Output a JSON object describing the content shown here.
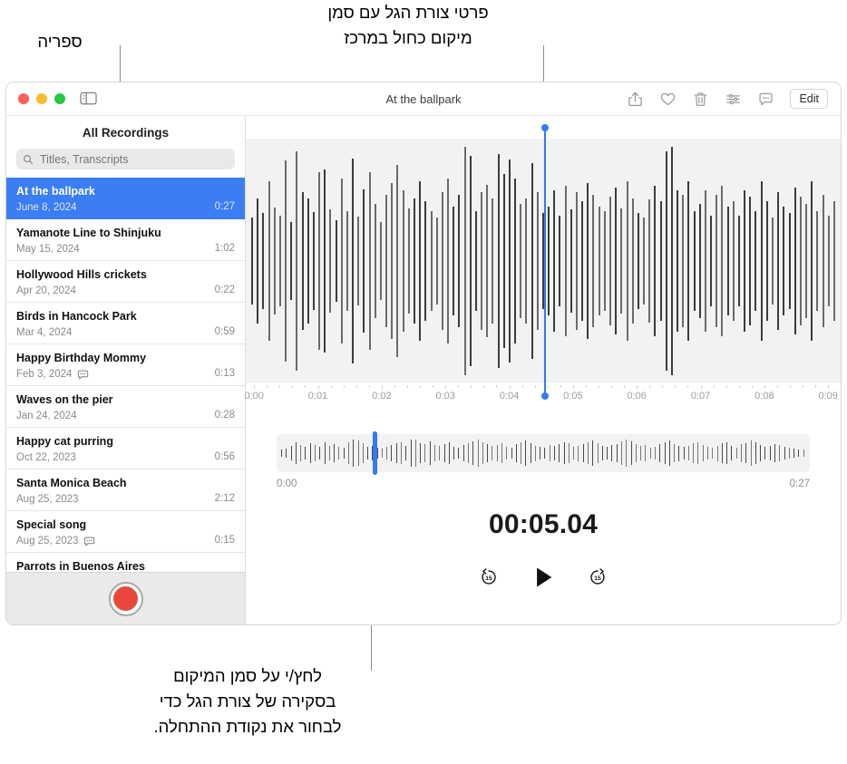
{
  "callouts": {
    "library": "ספריה",
    "waveform": "פרטי צורת הגל עם סמן\nמיקום כחול במרכז",
    "scrubber": "לחץ/י על סמן המיקום\nבסקירה של צורת הגל כדי\nלבחור את נקודת ההתחלה."
  },
  "window": {
    "title": "At the ballpark",
    "traffic_lights": [
      "close",
      "minimize",
      "zoom"
    ],
    "sidebar_toggle_icon": "sidebar-toggle-icon",
    "toolbar": {
      "items": [
        {
          "name": "share-icon",
          "label": "Share"
        },
        {
          "name": "favorite-icon",
          "label": "Favorite"
        },
        {
          "name": "trash-icon",
          "label": "Delete"
        },
        {
          "name": "enhance-icon",
          "label": "Enhance Recording"
        },
        {
          "name": "transcript-icon",
          "label": "Transcript"
        }
      ],
      "edit_label": "Edit"
    }
  },
  "sidebar": {
    "header": "All Recordings",
    "search": {
      "placeholder": "Titles, Transcripts",
      "value": "",
      "icon": "search-icon"
    },
    "recordings": [
      {
        "title": "At the ballpark",
        "date": "June 8, 2024",
        "duration": "0:27",
        "selected": true,
        "transcript": false
      },
      {
        "title": "Yamanote Line to Shinjuku",
        "date": "May 15, 2024",
        "duration": "1:02",
        "selected": false,
        "transcript": false
      },
      {
        "title": "Hollywood Hills crickets",
        "date": "Apr 20, 2024",
        "duration": "0:22",
        "selected": false,
        "transcript": false
      },
      {
        "title": "Birds in Hancock Park",
        "date": "Mar 4, 2024",
        "duration": "0:59",
        "selected": false,
        "transcript": false
      },
      {
        "title": "Happy Birthday Mommy",
        "date": "Feb 3, 2024",
        "duration": "0:13",
        "selected": false,
        "transcript": true
      },
      {
        "title": "Waves on the pier",
        "date": "Jan 24, 2024",
        "duration": "0:28",
        "selected": false,
        "transcript": false
      },
      {
        "title": "Happy cat purring",
        "date": "Oct 22, 2023",
        "duration": "0:56",
        "selected": false,
        "transcript": false
      },
      {
        "title": "Santa Monica Beach",
        "date": "Aug 25, 2023",
        "duration": "2:12",
        "selected": false,
        "transcript": false
      },
      {
        "title": "Special song",
        "date": "Aug 25, 2023",
        "duration": "0:15",
        "selected": false,
        "transcript": true
      },
      {
        "title": "Parrots in Buenos Aires",
        "date": "",
        "duration": "",
        "selected": false,
        "transcript": false
      }
    ],
    "record_button": "record-button"
  },
  "player": {
    "current_time": "00:05.04",
    "overview_start": "0:00",
    "overview_end": "0:27",
    "playhead_percent": 50.2,
    "scrubber_percent": 18.5,
    "timeline_ticks": [
      "0:00",
      "0:01",
      "0:02",
      "0:03",
      "0:04",
      "0:05",
      "0:06",
      "0:07",
      "0:08",
      "0:09"
    ],
    "transport": {
      "skip_back": "15",
      "skip_forward": "15",
      "play_label": "Play"
    }
  },
  "colors": {
    "accent_blue": "#3b7ef3",
    "playhead_blue": "#2f7cf6",
    "record_red": "#e8483c",
    "waveform_bg": "#f2f2f2"
  },
  "waveform_detail": [
    38,
    55,
    42,
    70,
    47,
    40,
    88,
    34,
    96,
    60,
    55,
    43,
    78,
    80,
    45,
    36,
    72,
    44,
    90,
    39,
    63,
    78,
    50,
    34,
    58,
    68,
    84,
    62,
    46,
    55,
    70,
    52,
    44,
    38,
    60,
    72,
    48,
    58,
    100,
    92,
    44,
    60,
    67,
    55,
    94,
    76,
    89,
    72,
    50,
    55,
    86,
    60,
    42,
    48,
    62,
    40,
    66,
    45,
    60,
    52,
    68,
    58,
    48,
    44,
    56,
    64,
    46,
    70,
    55,
    42,
    38,
    54,
    66,
    52,
    96,
    100,
    62,
    58,
    70,
    44,
    50,
    62,
    40,
    58,
    66,
    48,
    52,
    40,
    62,
    56,
    44,
    70,
    52,
    38,
    60,
    48,
    42,
    64,
    56,
    50,
    70,
    44,
    58,
    40,
    52
  ],
  "waveform_overview": [
    22,
    30,
    46,
    70,
    52,
    40,
    62,
    55,
    44,
    70,
    48,
    60,
    42,
    38,
    72,
    86,
    80,
    64,
    40,
    46,
    34,
    28,
    40,
    54,
    62,
    70,
    48,
    90,
    88,
    66,
    58,
    74,
    52,
    46,
    60,
    68,
    44,
    38,
    52,
    64,
    78,
    86,
    70,
    58,
    48,
    54,
    66,
    40,
    36,
    58,
    72,
    84,
    62,
    50,
    44,
    38,
    54,
    48,
    60,
    72,
    66,
    42,
    50,
    58,
    70,
    82,
    64,
    48,
    40,
    52,
    60,
    74,
    88,
    76,
    58,
    46,
    52,
    38,
    44,
    56,
    68,
    80,
    60,
    50,
    42,
    48,
    62,
    70,
    54,
    40,
    36,
    50,
    64,
    72,
    46,
    38,
    58,
    66,
    80,
    70,
    54,
    42,
    48,
    60,
    52,
    44,
    38,
    30,
    26,
    22
  ]
}
